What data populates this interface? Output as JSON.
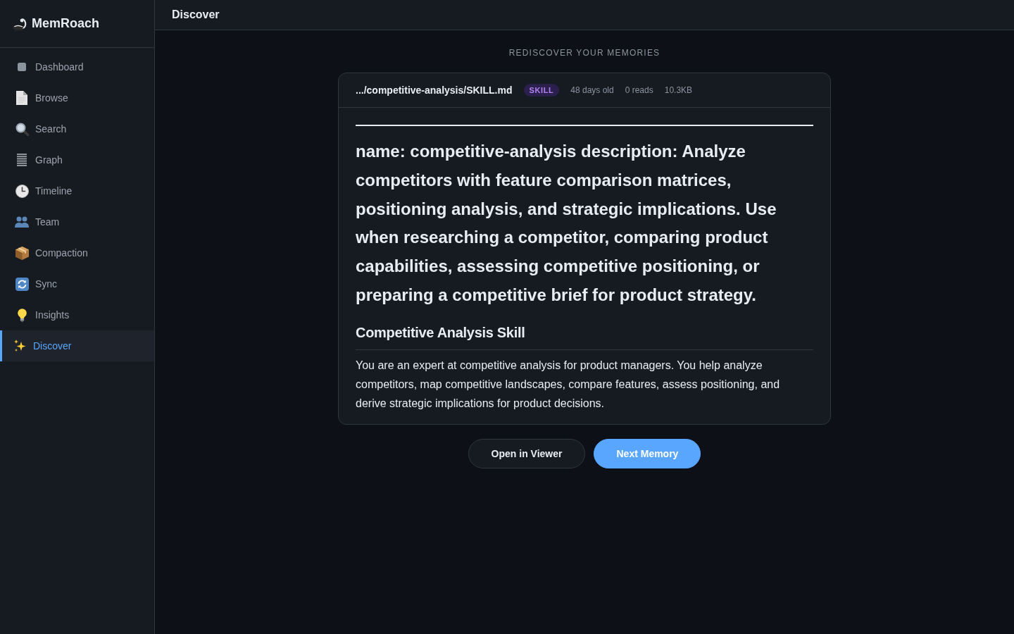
{
  "sidebar": {
    "logo": "MemRoach",
    "items": [
      {
        "label": "Dashboard",
        "selected": false
      },
      {
        "label": "Browse",
        "selected": false
      },
      {
        "label": "Search",
        "selected": false
      },
      {
        "label": "Graph",
        "selected": false
      },
      {
        "label": "Timeline",
        "selected": false
      },
      {
        "label": "Team",
        "selected": false
      },
      {
        "label": "Compaction",
        "selected": false
      },
      {
        "label": "Sync",
        "selected": false
      },
      {
        "label": "Insights",
        "selected": false
      },
      {
        "label": "Discover",
        "selected": true
      }
    ]
  },
  "header": {
    "title": "Discover"
  },
  "main": {
    "heading": "REDISCOVER YOUR MEMORIES",
    "card": {
      "path": ".../competitive-analysis/SKILL.md",
      "badge": "SKILL",
      "meta": [
        "48 days old",
        "0 reads",
        "10.3KB"
      ],
      "content": [
        {
          "kind": "rule"
        },
        {
          "kind": "heading1",
          "text": "name: competitive-analysis description: Analyze competitors with feature comparison matrices, positioning analysis, and strategic implications. Use when researching a competitor, comparing product capabilities, assessing competitive positioning, or preparing a competitive brief for product strategy."
        },
        {
          "kind": "heading2",
          "text": "Competitive Analysis Skill"
        },
        {
          "kind": "paragraph",
          "text": "You are an expert at competitive analysis for product managers. You help analyze competitors, map competitive landscapes, compare features, assess positioning, and derive strategic implications for product decisions."
        }
      ]
    },
    "buttons": [
      {
        "label": "Open in Viewer",
        "kind": "secondary"
      },
      {
        "label": "Next Memory",
        "kind": "primary"
      }
    ]
  }
}
